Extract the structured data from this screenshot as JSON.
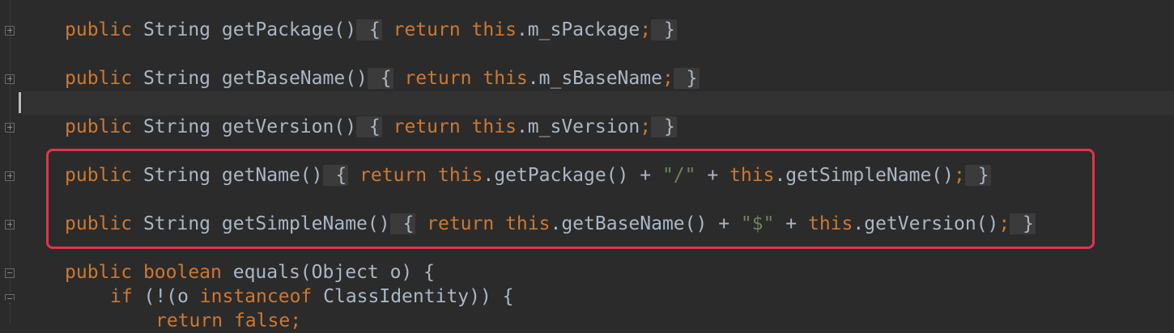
{
  "editor": {
    "lines": [
      {
        "id": "getPackage",
        "mod": "public",
        "sig": " String getPackage()",
        "open": " {",
        "ret": " return",
        "self": " this",
        "body": ".m_sPackage",
        "semi": ";",
        "close": " }"
      },
      {
        "id": "getBaseName",
        "mod": "public",
        "sig": " String getBaseName()",
        "open": " {",
        "ret": " return",
        "self": " this",
        "body": ".m_sBaseName",
        "semi": ";",
        "close": " }"
      },
      {
        "id": "getVersion",
        "mod": "public",
        "sig": " String getVersion()",
        "open": " {",
        "ret": " return",
        "self": " this",
        "body": ".m_sVersion",
        "semi": ";",
        "close": " }"
      },
      {
        "id": "getName",
        "mod": "public",
        "sig": " String getName()",
        "open": " {",
        "ret": " return",
        "self": " this",
        "body1": ".getPackage() + ",
        "str": "\"/\"",
        "plus": " + ",
        "self2": "this",
        "body2": ".getSimpleName()",
        "semi": ";",
        "close": " }"
      },
      {
        "id": "getSimpleName",
        "mod": "public",
        "sig": " String getSimpleName()",
        "open": " {",
        "ret": " return",
        "self": " this",
        "body1": ".getBaseName() + ",
        "str": "\"$\"",
        "plus": " + ",
        "self2": "this",
        "body2": ".getVersion()",
        "semi": ";",
        "close": " }"
      },
      {
        "id": "equals",
        "mod": "public",
        "type": " boolean",
        "sig": " equals(Object o) {"
      },
      {
        "id": "if",
        "kw": "if",
        "pre": " (!(o ",
        "kw2": "instanceof",
        "post": " ClassIdentity)) {"
      },
      {
        "id": "return-false",
        "kw": "return",
        "kw2": " false",
        "post": ";"
      }
    ]
  },
  "colors": {
    "background": "#2b2b2b",
    "keyword": "#cc7832",
    "identifier": "#a9b7c6",
    "string": "#6a8759",
    "highlight": "#e5334a"
  }
}
